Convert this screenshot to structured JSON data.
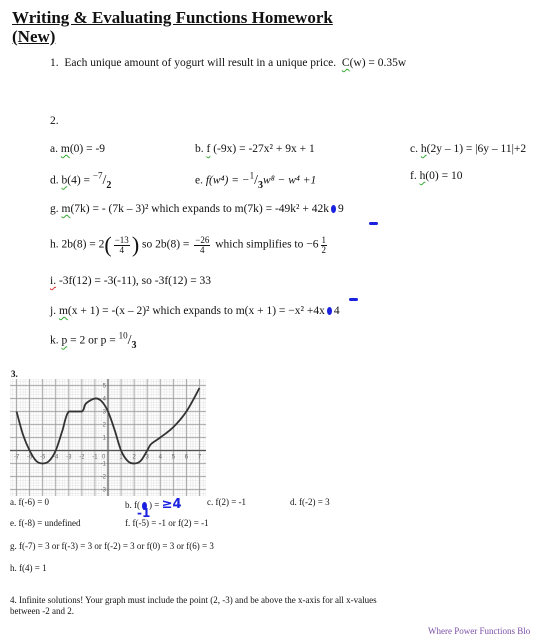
{
  "title_line1": "Writing & Evaluating Functions Homework",
  "title_line2": "(New)",
  "q1": {
    "num": "1.",
    "text": "Each unique amount of yogurt will result in a unique price.",
    "fn": "C",
    "rest": "(w) = 0.35w"
  },
  "q2": {
    "num": "2.",
    "a": {
      "label": "a.",
      "fn": "m",
      "rest": "(0) = -9"
    },
    "b": {
      "label": "b.",
      "fn": "f",
      "rest": " (-9x) = -27x² + 9x + 1"
    },
    "c": {
      "label": "c.",
      "fn": "h",
      "rest": "(2y – 1) = |6y – 11|+2"
    },
    "d": {
      "label": "d.",
      "fn": "b",
      "rest": "(4) = ",
      "frac_num": "−7",
      "frac_den": "2"
    },
    "e": {
      "label": "e.",
      "lhs": "f(w⁴) = −",
      "frac_num": "1",
      "frac_den": "3",
      "rhs": "w⁸ − w⁴ +1"
    },
    "f": {
      "label": "f.",
      "fn": "h",
      "rest": "(0) = 10"
    },
    "g": {
      "label": "g.",
      "fn": "m",
      "rest": "(7k) = - (7k – 3)² which expands to m(7k) = -49k² + 42k",
      "tail": "9"
    },
    "h": {
      "label": "h.",
      "lhs": "2b(8) = 2",
      "f1_num": "−13",
      "f1_den": "4",
      "mid": "so 2b(8) = ",
      "f2_num": "−26",
      "f2_den": "4",
      "end": "which simplifies to −6",
      "f3_num": "1",
      "f3_den": "2"
    },
    "i": {
      "label": "i.",
      "rest": "-3f(12) = -3(-11), so -3f(12) = 33"
    },
    "j": {
      "label": "j.",
      "fn": "m",
      "rest": "(x + 1) = -(x – 2)² which expands to m(x + 1) = −x² +4x",
      "tail": "4"
    },
    "k": {
      "label": "k.",
      "fn": "p",
      "rest": " = 2 or p = ",
      "frac_num": "10",
      "frac_den": "3"
    }
  },
  "q3": {
    "num": "3.",
    "graph": {
      "x_ticks": [
        "-7",
        "-6",
        "-5",
        "-4",
        "-3",
        "-2",
        "-1",
        "0",
        "1",
        "2",
        "3",
        "4",
        "5",
        "6",
        "7"
      ],
      "y_ticks": [
        "5",
        "4",
        "3",
        "2",
        "1",
        "-1",
        "-2",
        "-3"
      ],
      "xlim": [
        -7.5,
        7.5
      ],
      "ylim": [
        -3.5,
        5.5
      ],
      "curve_points": [
        [
          -7,
          3
        ],
        [
          -6.5,
          1.2
        ],
        [
          -6,
          0
        ],
        [
          -5.5,
          -0.8
        ],
        [
          -5,
          -1
        ],
        [
          -4.5,
          -0.8
        ],
        [
          -4,
          0
        ],
        [
          -3.5,
          1.5
        ],
        [
          -3,
          3
        ],
        [
          -2,
          3
        ],
        [
          -1.7,
          3.6
        ],
        [
          -1,
          4
        ],
        [
          -0.5,
          3.8
        ],
        [
          0,
          3
        ],
        [
          0.5,
          1.6
        ],
        [
          1,
          0
        ],
        [
          1.5,
          -0.8
        ],
        [
          2,
          -1
        ],
        [
          2.5,
          -0.8
        ],
        [
          3,
          0
        ],
        [
          3.3,
          0.5
        ],
        [
          4,
          1
        ],
        [
          5,
          1.8
        ],
        [
          6,
          3
        ],
        [
          7,
          4.8
        ]
      ]
    },
    "answers": {
      "a": "a.  f(-6) = 0",
      "b_pre": "b.  f(",
      "b_post": ") = ",
      "b_hand_top": "≥4",
      "b_hand_bottom": "-1",
      "c": "c.  f(2) = -1",
      "d": "d.  f(-2) = 3",
      "e": "e.  f(-8) = undefined",
      "f": "f.  f(-5) = -1 or f(2) = -1",
      "g": "g.  f(-7) = 3 or f(-3) = 3 or f(-2) = 3 or f(0) = 3 or f(6) = 3",
      "h": "h.  f(4) = 1"
    }
  },
  "q4": {
    "line1": "4.  Infinite solutions!  Your graph must include the point (2, -3) and be above the x-axis for all x-values",
    "line2": "between -2 and 2."
  },
  "footer": "Where Power Functions Blo"
}
